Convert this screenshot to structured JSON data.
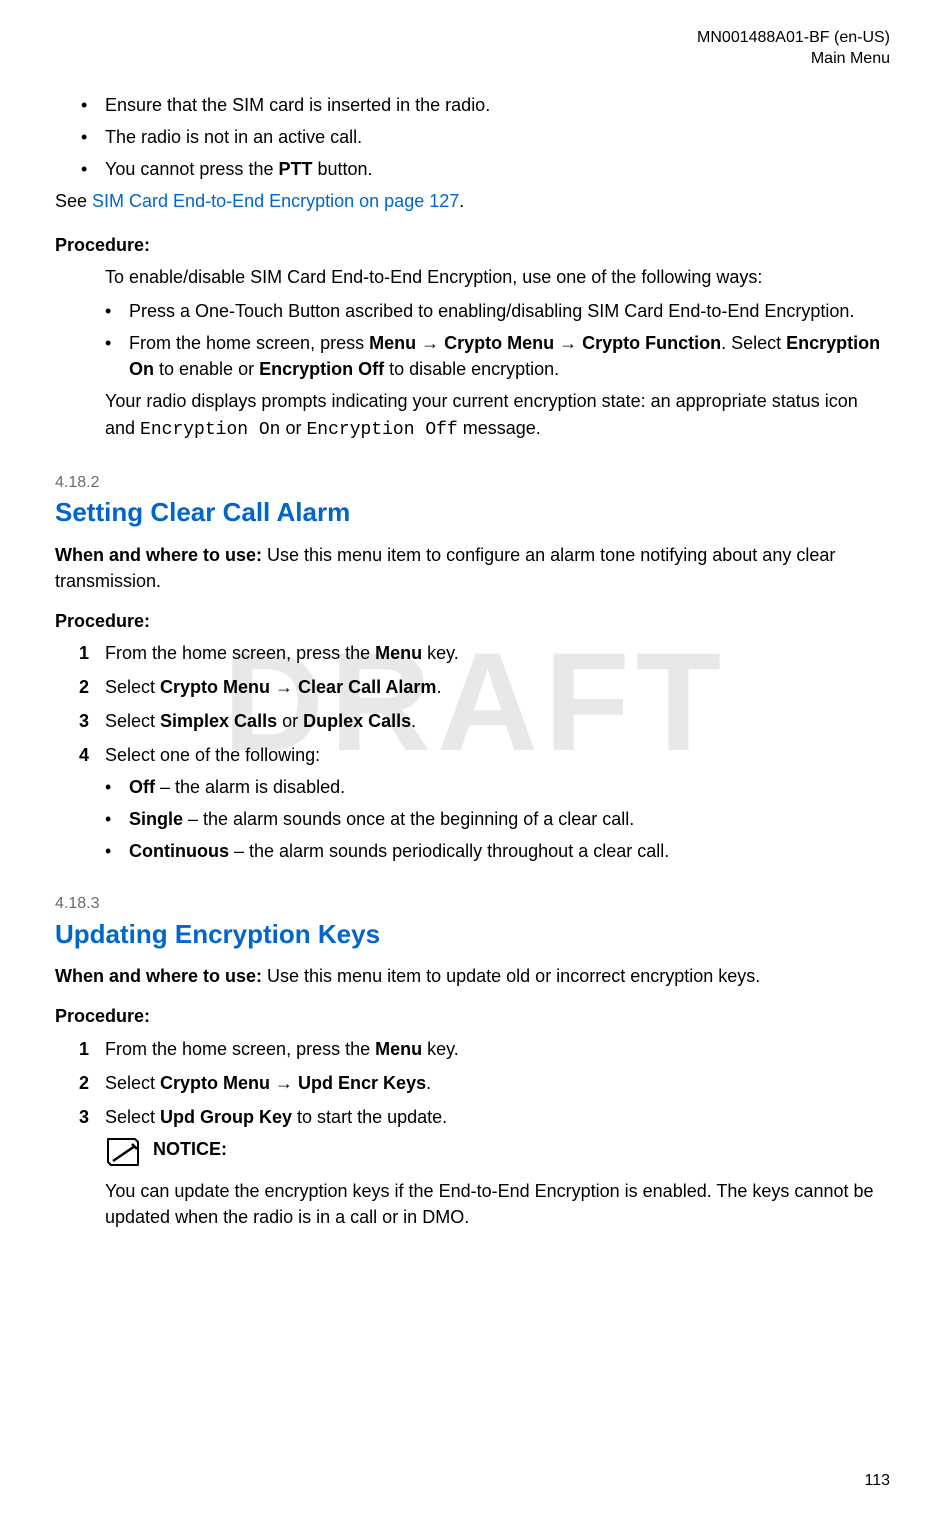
{
  "header": {
    "doc_id": "MN001488A01-BF (en-US)",
    "chapter": "Main Menu"
  },
  "watermark": "DRAFT",
  "intro_bullets": [
    "Ensure that the SIM card is inserted in the radio.",
    "The radio is not in an active call."
  ],
  "intro_bullet3_pre": "You cannot press the ",
  "intro_bullet3_bold": "PTT",
  "intro_bullet3_post": " button.",
  "see_text": "See ",
  "see_link": "SIM Card End-to-End Encryption on page 127",
  "see_period": ".",
  "proc_label": "Procedure:",
  "proc1_intro": "To enable/disable SIM Card End-to-End Encryption, use one of the following ways:",
  "proc1_bullet1": "Press a One-Touch Button ascribed to enabling/disabling SIM Card End-to-End Encryption.",
  "proc1_b2_a": "From the home screen, press ",
  "proc1_b2_b": "Menu",
  "proc1_b2_c": " → ",
  "proc1_b2_d": "Crypto Menu",
  "proc1_b2_e": " → ",
  "proc1_b2_f": "Crypto Function",
  "proc1_b2_g": ". Select ",
  "proc1_b2_h": "Encryption On",
  "proc1_b2_i": " to enable or ",
  "proc1_b2_j": "Encryption Off",
  "proc1_b2_k": " to disable encryption.",
  "proc1_result_a": "Your radio displays prompts indicating your current encryption state: an appropriate status icon and ",
  "proc1_result_b": "Encryption On",
  "proc1_result_c": " or ",
  "proc1_result_d": "Encryption Off",
  "proc1_result_e": " message.",
  "s2_num": "4.18.2",
  "s2_title": "Setting Clear Call Alarm",
  "s2_when_label": "When and where to use: ",
  "s2_when_text": "Use this menu item to configure an alarm tone notifying about any clear transmission.",
  "s2_step1_a": "From the home screen, press the ",
  "s2_step1_b": "Menu",
  "s2_step1_c": " key.",
  "s2_step2_a": "Select ",
  "s2_step2_b": "Crypto Menu",
  "s2_step2_c": " → ",
  "s2_step2_d": "Clear Call Alarm",
  "s2_step2_e": ".",
  "s2_step3_a": "Select ",
  "s2_step3_b": "Simplex Calls",
  "s2_step3_c": " or ",
  "s2_step3_d": "Duplex Calls",
  "s2_step3_e": ".",
  "s2_step4": "Select one of the following:",
  "s2_opt1_a": "Off",
  "s2_opt1_b": " – the alarm is disabled.",
  "s2_opt2_a": "Single",
  "s2_opt2_b": " – the alarm sounds once at the beginning of a clear call.",
  "s2_opt3_a": "Continuous",
  "s2_opt3_b": " – the alarm sounds periodically throughout a clear call.",
  "s3_num": "4.18.3",
  "s3_title": "Updating Encryption Keys",
  "s3_when_label": "When and where to use: ",
  "s3_when_text": "Use this menu item to update old or incorrect encryption keys.",
  "s3_step1_a": "From the home screen, press the ",
  "s3_step1_b": "Menu",
  "s3_step1_c": " key.",
  "s3_step2_a": "Select ",
  "s3_step2_b": "Crypto Menu",
  "s3_step2_c": " → ",
  "s3_step2_d": "Upd Encr Keys",
  "s3_step2_e": ".",
  "s3_step3_a": "Select ",
  "s3_step3_b": "Upd Group Key",
  "s3_step3_c": " to start the update.",
  "notice_label": "NOTICE:",
  "notice_body": "You can update the encryption keys if the End-to-End Encryption is enabled. The keys cannot be updated when the radio is in a call or in DMO.",
  "nums": {
    "1": "1",
    "2": "2",
    "3": "3",
    "4": "4"
  },
  "page_number": "113"
}
